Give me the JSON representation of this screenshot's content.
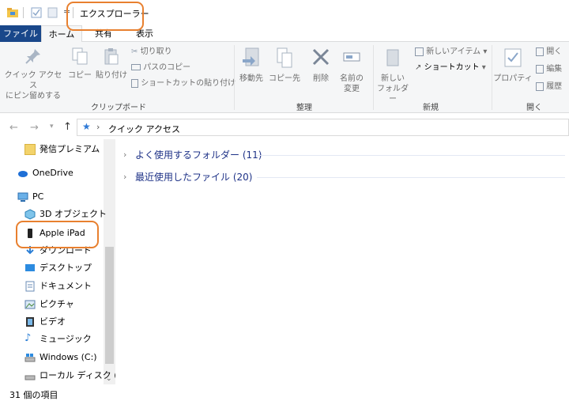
{
  "window": {
    "title": "エクスプローラー"
  },
  "tabs": [
    {
      "label": "ファイル"
    },
    {
      "label": "ホーム"
    },
    {
      "label": "共有"
    },
    {
      "label": "表示"
    }
  ],
  "ribbon": {
    "clipboard": {
      "pin": "クイック アクセス\nにピン留めする",
      "copy": "コピー",
      "paste": "貼り付け",
      "cut": "切り取り",
      "copy_path": "パスのコピー",
      "paste_shortcut": "ショートカットの貼り付け",
      "group": "クリップボード"
    },
    "organize": {
      "move_to": "移動先",
      "copy_to": "コピー先",
      "delete": "削除",
      "rename": "名前の\n変更",
      "group": "整理"
    },
    "new": {
      "new_folder": "新しい\nフォルダー",
      "new_item": "新しいアイテム",
      "shortcut": "ショートカット",
      "group": "新規"
    },
    "open": {
      "properties": "プロパティ",
      "open": "開く",
      "edit": "編集",
      "history": "履歴",
      "group": "開く"
    }
  },
  "address": {
    "location": "クイック アクセス"
  },
  "nav_pane": [
    {
      "label": "発信プレミアム",
      "icon": "folder-icon"
    },
    {
      "label": "OneDrive",
      "icon": "cloud-icon"
    },
    {
      "label": "PC",
      "icon": "pc-icon"
    },
    {
      "label": "3D オブジェクト",
      "icon": "cube-icon"
    },
    {
      "label": "Apple iPad",
      "icon": "tablet-icon"
    },
    {
      "label": "ダウンロード",
      "icon": "download-icon"
    },
    {
      "label": "デスクトップ",
      "icon": "desktop-icon"
    },
    {
      "label": "ドキュメント",
      "icon": "document-icon"
    },
    {
      "label": "ピクチャ",
      "icon": "picture-icon"
    },
    {
      "label": "ビデオ",
      "icon": "video-icon"
    },
    {
      "label": "ミュージック",
      "icon": "music-icon"
    },
    {
      "label": "Windows (C:)",
      "icon": "drive-icon"
    },
    {
      "label": "ローカル ディスク (D",
      "icon": "drive-icon"
    }
  ],
  "groups": [
    {
      "label": "よく使用するフォルダー (11)"
    },
    {
      "label": "最近使用したファイル (20)"
    }
  ],
  "status": {
    "item_count": "31 個の項目"
  },
  "colors": {
    "accent": "#19478a",
    "annotation": "#e8802f",
    "group_text": "#1e3287"
  }
}
